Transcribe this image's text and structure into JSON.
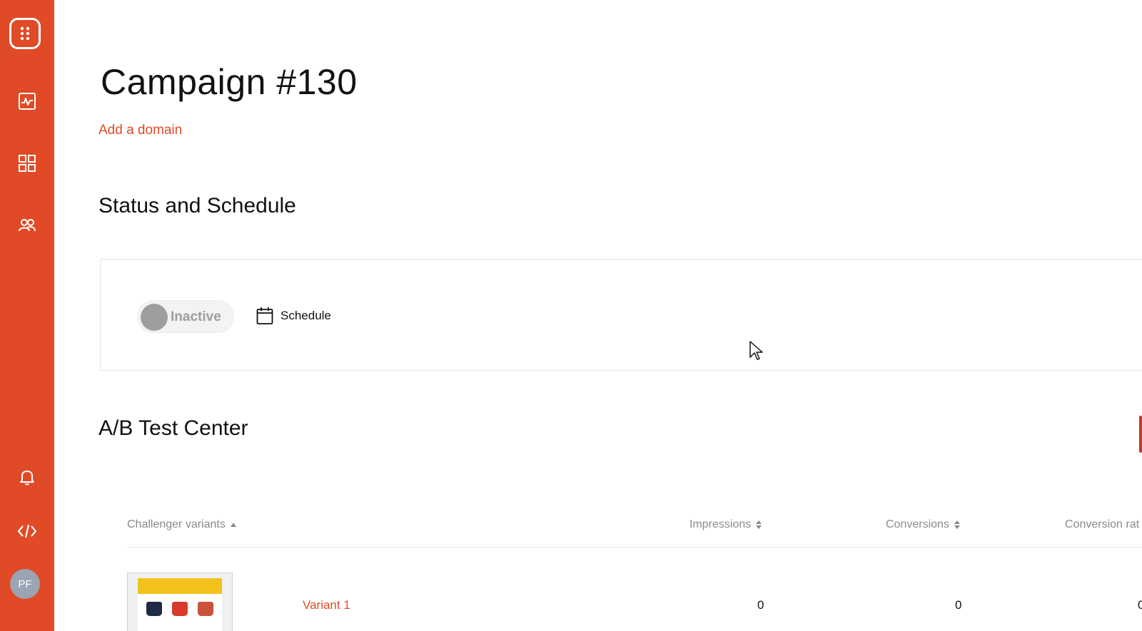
{
  "sidebar": {
    "avatar_initials": "PF",
    "brand_color": "#e04a26",
    "icons": [
      "logo-icon",
      "analytics-icon",
      "grid-icon",
      "users-icon",
      "bell-icon",
      "code-icon"
    ]
  },
  "page": {
    "title": "Campaign #130",
    "add_domain_label": "Add a domain"
  },
  "status_section": {
    "title": "Status and Schedule",
    "toggle_label": "Inactive",
    "toggle_state": "off",
    "schedule_label": "Schedule"
  },
  "ab_section": {
    "title": "A/B Test Center",
    "columns": [
      "Challenger variants",
      "Impressions",
      "Conversions",
      "Conversion rat"
    ],
    "rows": [
      {
        "variant": "Variant 1",
        "impressions": "0",
        "conversions": "0",
        "rate": "0"
      }
    ]
  }
}
